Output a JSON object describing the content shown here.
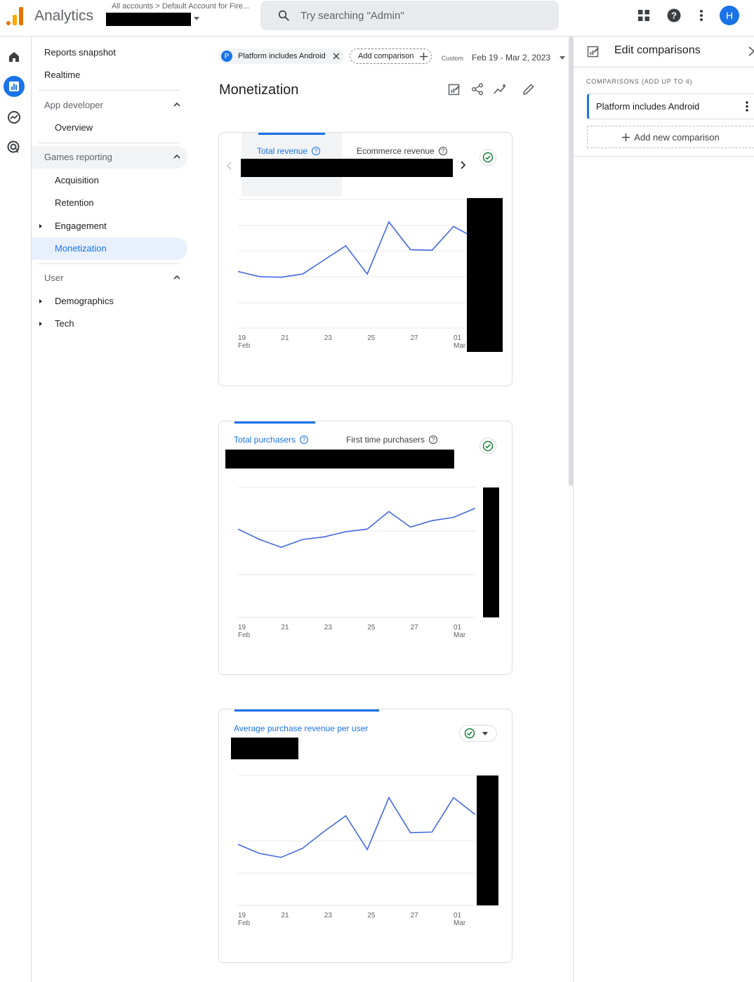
{
  "app": {
    "title": "Analytics",
    "account_path": "All accounts > Default Account for Fire..."
  },
  "search": {
    "placeholder": "Try searching \"Admin\""
  },
  "topbar": {
    "avatar_initial": "H"
  },
  "nav": {
    "reports_snapshot": "Reports snapshot",
    "realtime": "Realtime",
    "app_developer": {
      "label": "App developer",
      "items": [
        "Overview"
      ]
    },
    "games_reporting": {
      "label": "Games reporting",
      "items": [
        "Acquisition",
        "Retention",
        "Engagement",
        "Monetization"
      ]
    },
    "user": {
      "label": "User",
      "items": [
        "Demographics",
        "Tech"
      ]
    }
  },
  "toolbar": {
    "comparison_chip": {
      "initial": "P",
      "label": "Platform includes Android"
    },
    "add_comparison": "Add comparison",
    "date_badge": "Custom",
    "date_range": "Feb 19 - Mar 2, 2023"
  },
  "page": {
    "title": "Monetization"
  },
  "cards": [
    {
      "tabs": [
        "Total revenue",
        "Ecommerce revenue"
      ],
      "selected_tab": 0
    },
    {
      "tabs": [
        "Total purchasers",
        "First time purchasers"
      ],
      "selected_tab": 0
    },
    {
      "tabs": [
        "Average purchase revenue per user"
      ],
      "selected_tab": 0
    }
  ],
  "chart_data": [
    {
      "type": "line",
      "x": [
        "Feb 19",
        "Feb 20",
        "Feb 21",
        "Feb 22",
        "Feb 23",
        "Feb 24",
        "Feb 25",
        "Feb 26",
        "Feb 27",
        "Feb 28",
        "Mar 01",
        "Mar 02"
      ],
      "xticks": [
        [
          "19",
          "Feb"
        ],
        [
          "21",
          ""
        ],
        [
          "23",
          ""
        ],
        [
          "25",
          ""
        ],
        [
          "27",
          ""
        ],
        [
          "01",
          "Mar"
        ]
      ],
      "series": [
        {
          "values": [
            0.44,
            0.4,
            0.395,
            0.42,
            0.53,
            0.64,
            0.42,
            0.825,
            0.61,
            0.605,
            0.79,
            0.7
          ]
        }
      ],
      "ylim": [
        0,
        1
      ],
      "grid": true,
      "color": "#4169e1"
    },
    {
      "type": "line",
      "x": [
        "Feb 19",
        "Feb 20",
        "Feb 21",
        "Feb 22",
        "Feb 23",
        "Feb 24",
        "Feb 25",
        "Feb 26",
        "Feb 27",
        "Feb 28",
        "Mar 01",
        "Mar 02"
      ],
      "xticks": [
        [
          "19",
          "Feb"
        ],
        [
          "21",
          ""
        ],
        [
          "23",
          ""
        ],
        [
          "25",
          ""
        ],
        [
          "27",
          ""
        ],
        [
          "01",
          "Mar"
        ]
      ],
      "series": [
        {
          "values": [
            0.68,
            0.6,
            0.54,
            0.6,
            0.62,
            0.66,
            0.68,
            0.815,
            0.695,
            0.745,
            0.77,
            0.84
          ]
        }
      ],
      "ylim": [
        0,
        1
      ],
      "grid": true,
      "color": "#4169e1"
    },
    {
      "type": "line",
      "x": [
        "Feb 19",
        "Feb 20",
        "Feb 21",
        "Feb 22",
        "Feb 23",
        "Feb 24",
        "Feb 25",
        "Feb 26",
        "Feb 27",
        "Feb 28",
        "Mar 01",
        "Mar 02"
      ],
      "xticks": [
        [
          "19",
          "Feb"
        ],
        [
          "21",
          ""
        ],
        [
          "23",
          ""
        ],
        [
          "25",
          ""
        ],
        [
          "27",
          ""
        ],
        [
          "01",
          "Mar"
        ]
      ],
      "series": [
        {
          "values": [
            0.47,
            0.4,
            0.37,
            0.44,
            0.57,
            0.69,
            0.43,
            0.83,
            0.56,
            0.565,
            0.83,
            0.7
          ]
        }
      ],
      "ylim": [
        0,
        1
      ],
      "grid": true,
      "color": "#4169e1"
    }
  ],
  "panel": {
    "title": "Edit comparisons",
    "subtitle": "COMPARISONS (ADD UP TO 4)",
    "comparisons": [
      "Platform includes Android"
    ],
    "add_new": "Add new comparison"
  },
  "colors": {
    "accent": "#1a73e8",
    "line": "#4169e1",
    "check": "#188038"
  }
}
